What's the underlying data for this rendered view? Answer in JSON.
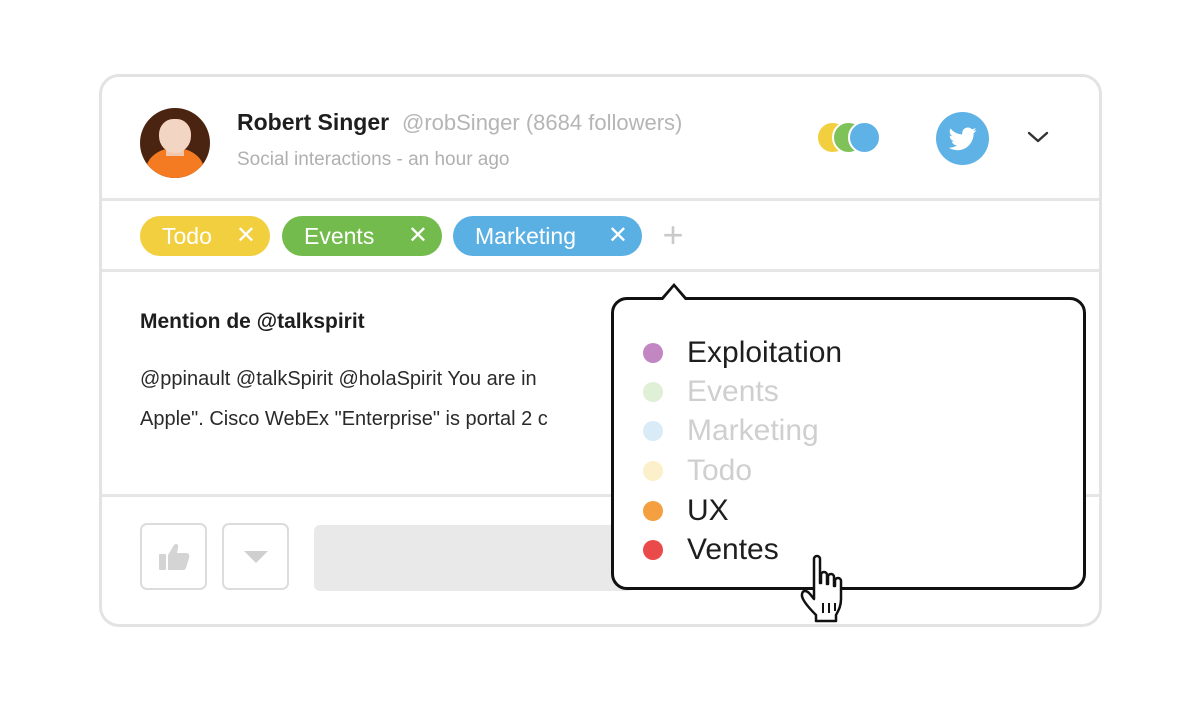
{
  "post": {
    "author_name": "Robert Singer",
    "author_handle": "@robSinger (8684 followers)",
    "meta": "Social interactions - an hour ago",
    "title": "Mention de @talkspirit",
    "body_line1": "@ppinault @talkSpirit @holaSpirit You are in",
    "body_line2": "Apple\". Cisco WebEx \"Enterprise\" is portal 2 c"
  },
  "header": {
    "assignee_colors": [
      "#f2cf3e",
      "#7fc25a",
      "#5fb2e6"
    ],
    "twitter_icon": "twitter-bird-icon",
    "twitter_color": "#5fb2e6",
    "chevron_icon": "chevron-down-icon"
  },
  "tags": [
    {
      "label": "Todo",
      "color": "#f2cf3e",
      "remove": "✕"
    },
    {
      "label": "Events",
      "color": "#73bb4c",
      "remove": "✕"
    },
    {
      "label": "Marketing",
      "color": "#5bb0e3",
      "remove": "✕"
    }
  ],
  "add_tag_label": "+",
  "actions": {
    "like_icon": "thumbs-up-icon",
    "menu_icon": "caret-down-icon"
  },
  "tag_menu": {
    "options": [
      {
        "label": "Exploitation",
        "color": "#c287c2",
        "available": true
      },
      {
        "label": "Events",
        "color": "#dff0d6",
        "available": false
      },
      {
        "label": "Marketing",
        "color": "#d8ebf7",
        "available": false
      },
      {
        "label": "Todo",
        "color": "#fbf0c9",
        "available": false
      },
      {
        "label": "UX",
        "color": "#f4a040",
        "available": true
      },
      {
        "label": "Ventes",
        "color": "#ea4a4a",
        "available": true
      }
    ],
    "active_text_color": "#1e1e1e",
    "disabled_text_color": "#cfcfcf"
  },
  "cursor_icon": "hand-pointer-icon"
}
